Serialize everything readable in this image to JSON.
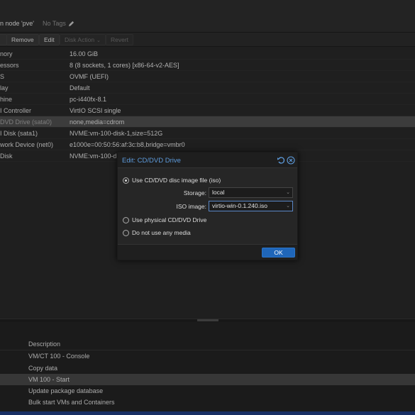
{
  "header": {
    "title": "n node 'pve'",
    "tags": "No Tags"
  },
  "toolbar": {
    "remove_label": "Remove",
    "edit_label": "Edit",
    "disk_action_label": "Disk Action",
    "revert_label": "Revert"
  },
  "hardware": [
    {
      "key": "nory",
      "value": "16.00 GiB"
    },
    {
      "key": "essors",
      "value": "8 (8 sockets, 1 cores) [x86-64-v2-AES]"
    },
    {
      "key": "S",
      "value": "OVMF (UEFI)"
    },
    {
      "key": "lay",
      "value": "Default"
    },
    {
      "key": "hine",
      "value": "pc-i440fx-8.1"
    },
    {
      "key": "I Controller",
      "value": "VirtIO SCSI single"
    },
    {
      "key": "DVD Drive (sata0)",
      "value": "none,media=cdrom"
    },
    {
      "key": "I Disk (sata1)",
      "value": "NVME:vm-100-disk-1,size=512G"
    },
    {
      "key": "work Device (net0)",
      "value": "e1000e=00:50:56:af:3c:b8,bridge=vmbr0"
    },
    {
      "key": "Disk",
      "value": "NVME:vm-100-di"
    }
  ],
  "tasks": {
    "header": "Description",
    "rows": [
      {
        "desc": "VM/CT 100 - Console"
      },
      {
        "desc": "Copy data"
      },
      {
        "desc": "VM 100 - Start"
      },
      {
        "desc": "Update package database"
      },
      {
        "desc": "Bulk start VMs and Containers"
      }
    ]
  },
  "dialog": {
    "title": "Edit: CD/DVD Drive",
    "option_iso": "Use CD/DVD disc image file (iso)",
    "storage_label": "Storage:",
    "storage_value": "local",
    "iso_label": "ISO image:",
    "iso_value": "virtio-win-0.1.240.iso",
    "option_physical": "Use physical CD/DVD Drive",
    "option_none": "Do not use any media",
    "ok_label": "OK"
  },
  "colors": {
    "accent": "#1f66b9",
    "dialog_title": "#5d9bdc"
  }
}
